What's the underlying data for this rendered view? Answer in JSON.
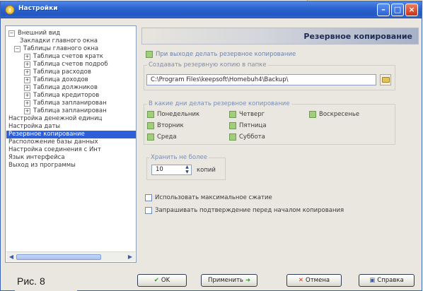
{
  "window": {
    "title": "Настройки"
  },
  "tree": {
    "items": [
      {
        "label": "Внешний вид",
        "expander": "−"
      },
      {
        "label": "Закладки главного окна",
        "expander": ""
      },
      {
        "label": "Таблицы главного окна",
        "expander": "−"
      },
      {
        "label": "Таблица счетов кратк",
        "expander": "+"
      },
      {
        "label": "Таблица счетов подроб",
        "expander": "+"
      },
      {
        "label": "Таблица расходов",
        "expander": "+"
      },
      {
        "label": "Таблица доходов",
        "expander": "+"
      },
      {
        "label": "Таблица должников",
        "expander": "+"
      },
      {
        "label": "Таблица кредиторов",
        "expander": "+"
      },
      {
        "label": "Таблица запланирован",
        "expander": "+"
      },
      {
        "label": "Таблица запланирован",
        "expander": "+"
      },
      {
        "label": "Настройка денежной единиц",
        "expander": ""
      },
      {
        "label": "Настройка даты",
        "expander": ""
      },
      {
        "label": "Резервное копирование",
        "expander": ""
      },
      {
        "label": "Расположение базы данных",
        "expander": ""
      },
      {
        "label": "Настройка соединения с Инт",
        "expander": ""
      },
      {
        "label": "Язык интерфейса",
        "expander": ""
      },
      {
        "label": "Выход из программы",
        "expander": ""
      }
    ],
    "selected_label": "Резервное копирование"
  },
  "panel": {
    "title": "Резервное копирование",
    "backup_on_exit": {
      "label": "При выходе делать резервное копирование",
      "checked": true
    },
    "folder": {
      "label": "Создавать резервную копию в папке",
      "path": "C:\\Program Files\\keepsoft\\Homebuh4\\Backup\\"
    },
    "days": {
      "label": "В какие дни делать резервное копирование",
      "items": [
        {
          "label": "Понедельник",
          "checked": true
        },
        {
          "label": "Вторник",
          "checked": true
        },
        {
          "label": "Среда",
          "checked": true
        },
        {
          "label": "Четверг",
          "checked": true
        },
        {
          "label": "Пятница",
          "checked": true
        },
        {
          "label": "Суббота",
          "checked": true
        },
        {
          "label": "Воскресенье",
          "checked": true
        }
      ]
    },
    "keep": {
      "label": "Хранить не более",
      "value": "10",
      "unit": "копий"
    },
    "max_compression": {
      "label": "Использовать максимальное сжатие",
      "checked": false
    },
    "confirm_before": {
      "label": "Запрашивать подтверждение перед началом копирования",
      "checked": false
    }
  },
  "buttons": {
    "ok": "OK",
    "apply": "Применить",
    "cancel": "Отмена",
    "help": "Справка"
  },
  "figure_caption": "Рис. 8",
  "icons": [
    "app-icon",
    "folder-icon",
    "ok-check-icon",
    "apply-arrow-icon",
    "cancel-x-icon",
    "help-book-icon"
  ],
  "colors": {
    "titlebar": "#2a62cf",
    "selection": "#2e5ed8",
    "checked": "#9fcf79",
    "group_label": "#7a8db3"
  }
}
